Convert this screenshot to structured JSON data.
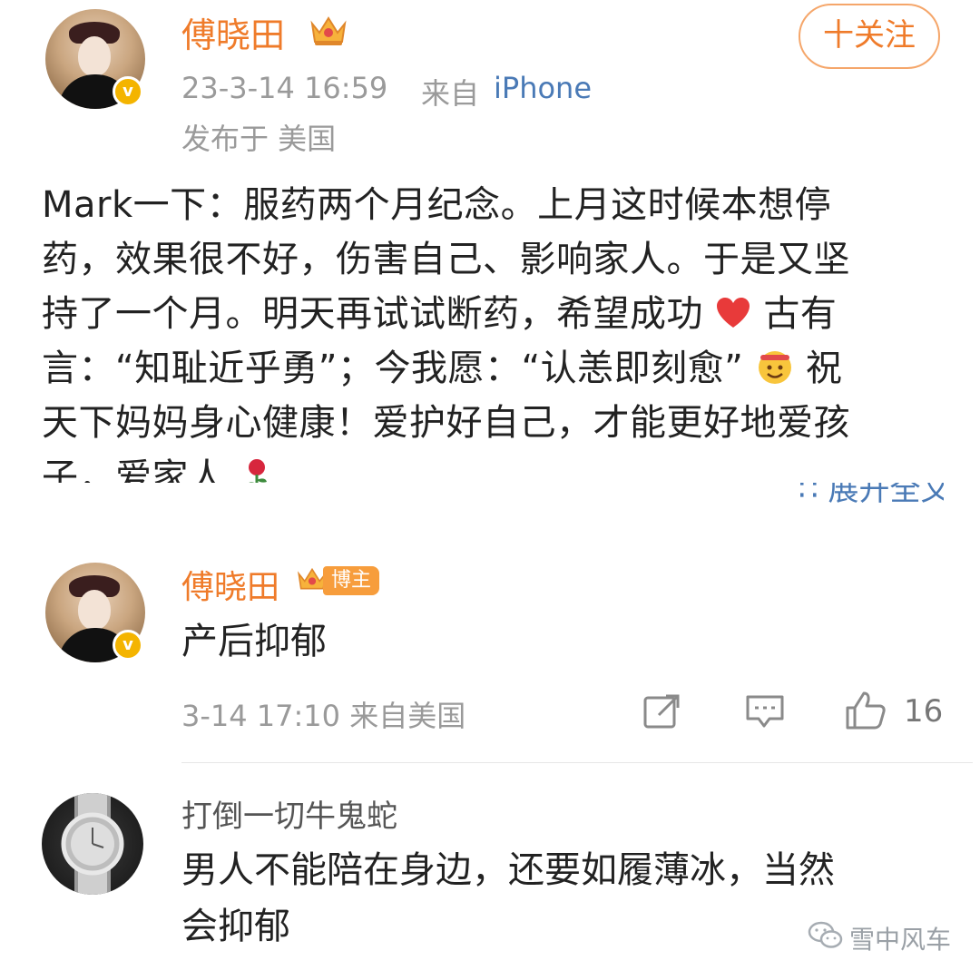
{
  "post": {
    "author": "傅晓田",
    "timestamp": "23-3-14 16:59",
    "source_prefix": "来自",
    "source_device": "iPhone",
    "location": "发布于 美国",
    "follow_label": "十关注",
    "body_lines": [
      "Mark一下：服药两个月纪念。上月这时候本想停",
      "药，效果很不好，伤害自己、影响家人。于是又坚",
      "持了一个月。明天再试试断药，希望成功",
      " 古有",
      "言：“知耻近乎勇”；今我愿：“认恙即刻愈”",
      " 祝",
      "天下妈妈身心健康！爱护好自己，才能更好地爱孩",
      "子，爱家人"
    ],
    "expand_label": "∷ 展开全文"
  },
  "comment_reply": {
    "author": "傅晓田",
    "badge": "博主",
    "text": "产后抑郁",
    "meta": "3-14 17:10 来自美国",
    "like_count": "16"
  },
  "comment_other": {
    "author": "打倒一切牛鬼蛇",
    "text_line1": "男人不能陪在身边，还要如履薄冰，当然",
    "text_line2": "会抑郁"
  },
  "watermark": {
    "text": "雪中风车"
  },
  "colors": {
    "author_orange": "#ef7b2a",
    "link_blue": "#4a7ab6",
    "meta_gray": "#9a9a9a",
    "badge_orange": "#f79d3c",
    "verify_gold": "#f4b400"
  },
  "icons": [
    "crown-icon",
    "verified-icon",
    "heart-emoji",
    "grin-emoji",
    "rose-emoji",
    "share-icon",
    "comment-icon",
    "like-icon",
    "wechat-icon"
  ]
}
